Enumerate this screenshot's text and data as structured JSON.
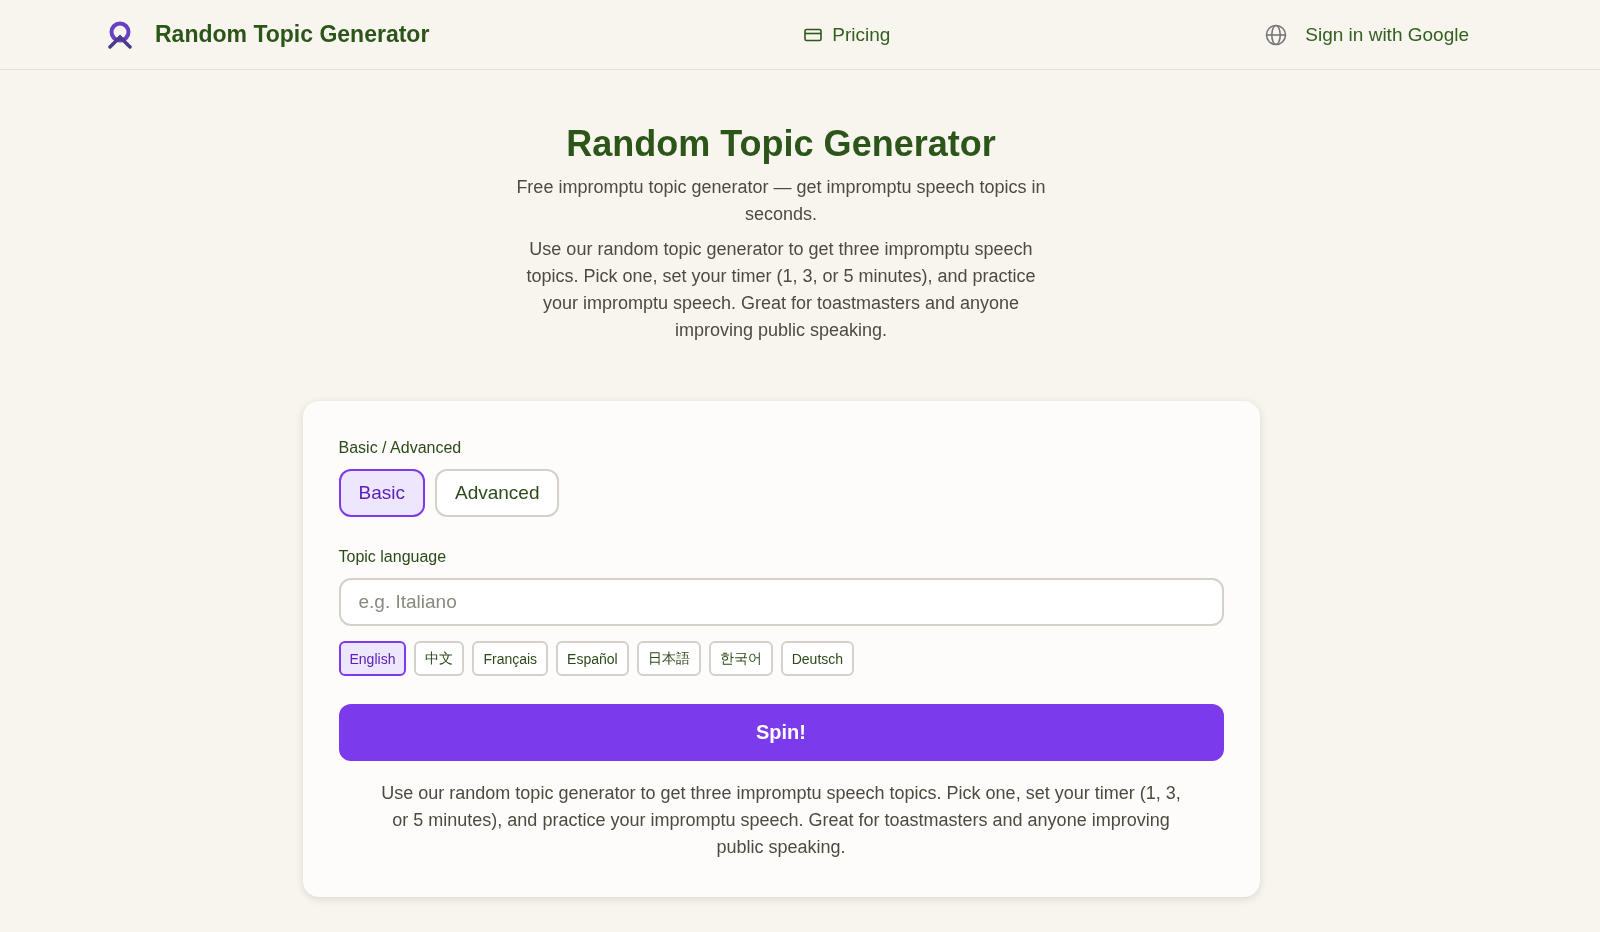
{
  "header": {
    "brand": "Random Topic Generator",
    "pricing": "Pricing",
    "sign_in": "Sign in with Google"
  },
  "hero": {
    "title": "Random Topic Generator",
    "subtitle": "Free impromptu topic generator — get impromptu speech topics in seconds.",
    "description": "Use our random topic generator to get three impromptu speech topics. Pick one, set your timer (1, 3, or 5 minutes), and practice your impromptu speech. Great for toastmasters and anyone improving public speaking."
  },
  "form": {
    "mode_label": "Basic / Advanced",
    "modes": [
      {
        "label": "Basic",
        "selected": true
      },
      {
        "label": "Advanced",
        "selected": false
      }
    ],
    "language_label": "Topic language",
    "language_input": {
      "placeholder": "e.g. Italiano"
    },
    "languages": [
      {
        "label": "English",
        "selected": true
      },
      {
        "label": "中文",
        "selected": false
      },
      {
        "label": "Français",
        "selected": false
      },
      {
        "label": "Español",
        "selected": false
      },
      {
        "label": "日本語",
        "selected": false
      },
      {
        "label": "한국어",
        "selected": false
      },
      {
        "label": "Deutsch",
        "selected": false
      }
    ],
    "spin_button": "Spin!",
    "description": "Use our random topic generator to get three impromptu speech topics. Pick one, set your timer (1, 3, or 5 minutes), and practice your impromptu speech. Great for toastmasters and anyone improving public speaking."
  }
}
